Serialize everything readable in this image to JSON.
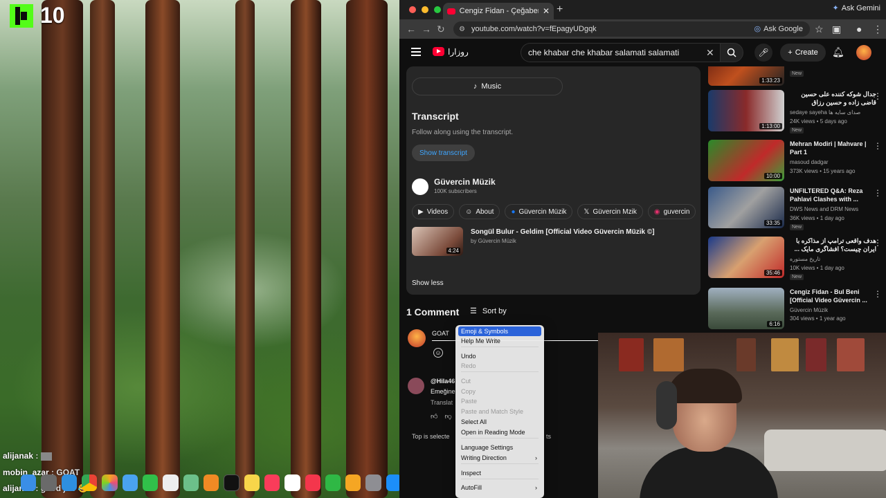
{
  "stream": {
    "viewer_count": "10",
    "chat": [
      {
        "user": "alijanak",
        "text": ":"
      },
      {
        "user": "mobin_azar",
        "text": ": GOAT"
      },
      {
        "user": "alijanak",
        "text": ": good job 😂"
      }
    ]
  },
  "browser": {
    "tab_title": "Cengiz Fidan - Çeğaber [Offi",
    "url": "youtube.com/watch?v=fEpagyUDgqk",
    "ask_google": "Ask Google",
    "ask_gemini": "Ask Gemini"
  },
  "youtube": {
    "logo_text": "ﺭﻭﺯﺍﺭﺍ",
    "search_query": "che khabar che khabar salamati salamati",
    "create_label": "Create",
    "music_label": "Music",
    "transcript_heading": "Transcript",
    "transcript_sub": "Follow along using the transcript.",
    "show_transcript": "Show transcript",
    "channel_name": "Güvercin Müzik",
    "channel_subs": "100K subscribers",
    "chips": [
      "Videos",
      "About",
      "Güvercin Müzik",
      "Güvercin Mzik",
      "guvercin"
    ],
    "featured": {
      "title": "Songül Bulur - Geldim [Official Video Güvercin Müzik ©]",
      "by": "by Güvercin Müzik",
      "duration": "4:24"
    },
    "show_less": "Show less",
    "comments_count": "1 Comment",
    "sort_by": "Sort by",
    "comment_input": "GOAT",
    "comment2_user": "@Hila46",
    "comment2_text": "Emeğine",
    "comment2_translate": "Translat",
    "top_selected": "Top is selecte",
    "top_selected_right": "ts"
  },
  "sidebar": [
    {
      "title": "",
      "channel": "",
      "meta": "",
      "duration": "1:33:23",
      "new": "New"
    },
    {
      "title": "جدال شوکه کننده علی حسین قاضی زاده و حسین رزاق",
      "channel": "sedaye sayeha صدای سایه ها",
      "meta": "24K views • 5 days ago",
      "duration": "1:13:00",
      "new": "New"
    },
    {
      "title": "Mehran Modiri | Mahvare | Part 1",
      "channel": "masoud dadgar",
      "meta": "373K views • 15 years ago",
      "duration": "10:00",
      "new": ""
    },
    {
      "title": "UNFILTERED Q&A: Reza Pahlavi Clashes with ...",
      "channel": "DWS News and DRM News",
      "meta": "36K views • 1 day ago",
      "duration": "33:35",
      "new": "New"
    },
    {
      "title": "هدف واقعی ترامپ از مذاکره با ایران چیست؟ افشاگری مایک ...",
      "channel": "تاریخ مستوره",
      "meta": "10K views • 1 day ago",
      "duration": "35:46",
      "new": "New"
    },
    {
      "title": "Cengiz Fidan - Bul Beni [Official Video Güvercin ...",
      "channel": "Güvercin Müzik",
      "meta": "304 views • 1 year ago",
      "duration": "6:16",
      "new": ""
    }
  ],
  "context_menu": [
    {
      "label": "Emoji & Symbols",
      "state": "highlighted"
    },
    {
      "label": "Help Me Write",
      "state": "normal"
    },
    {
      "label": "Undo",
      "state": "normal"
    },
    {
      "label": "Redo",
      "state": "disabled"
    },
    {
      "label": "Cut",
      "state": "disabled"
    },
    {
      "label": "Copy",
      "state": "disabled"
    },
    {
      "label": "Paste",
      "state": "disabled"
    },
    {
      "label": "Paste and Match Style",
      "state": "disabled"
    },
    {
      "label": "Select All",
      "state": "normal"
    },
    {
      "label": "Open in Reading Mode",
      "state": "normal"
    },
    {
      "label": "Language Settings",
      "state": "normal"
    },
    {
      "label": "Writing Direction",
      "state": "submenu"
    },
    {
      "label": "Inspect",
      "state": "normal"
    },
    {
      "label": "AutoFill",
      "state": "submenu"
    }
  ],
  "colors": {
    "accent_blue": "#3ea6ff",
    "yt_red": "#ff0033",
    "menu_highlight": "#2b63d9",
    "kick_green": "#53fc18"
  }
}
